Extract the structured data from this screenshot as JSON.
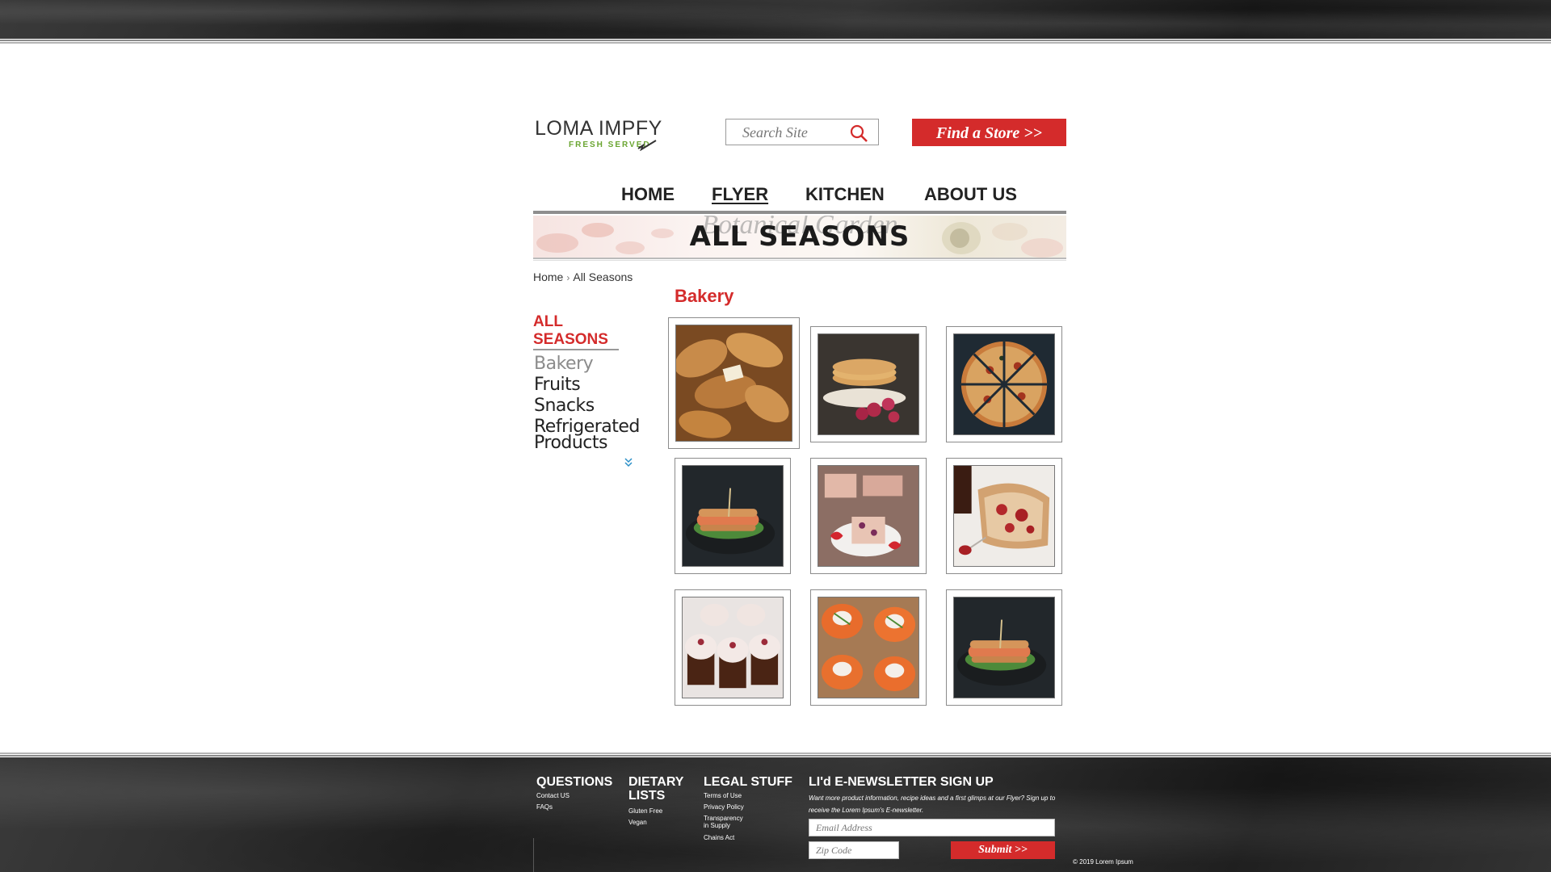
{
  "header": {
    "logo": {
      "brand": "LOMA IMPFY",
      "tagline": "FRESH SERVED"
    },
    "search": {
      "placeholder": "Search Site"
    },
    "find_store_label": "Find a Store >>"
  },
  "nav": {
    "items": [
      {
        "label": "HOME",
        "active": false
      },
      {
        "label": "FLYER",
        "active": true
      },
      {
        "label": "KITCHEN",
        "active": false
      },
      {
        "label": "ABOUT US",
        "active": false
      }
    ]
  },
  "banner": {
    "script_text": "Botanical Garden",
    "title": "ALL SEASONS"
  },
  "breadcrumb": {
    "home": "Home",
    "separator": "›",
    "current": "All Seasons"
  },
  "sidebar": {
    "heading": "ALL SEASONS",
    "items": [
      {
        "label": "Bakery",
        "current": true
      },
      {
        "label": "Fruits",
        "current": false
      },
      {
        "label": "Snacks",
        "current": false
      },
      {
        "label": "Refrigerated Products",
        "current": false
      }
    ],
    "more_icon": "chevron-double-down-icon"
  },
  "content": {
    "category_title": "Bakery",
    "products": [
      {
        "image": "bread-loaves",
        "selected": true
      },
      {
        "image": "pancakes-raspberries",
        "selected": false
      },
      {
        "image": "pizza-slices",
        "selected": false
      },
      {
        "image": "salmon-sandwich",
        "selected": false
      },
      {
        "image": "strawberry-cake",
        "selected": false
      },
      {
        "image": "bread-with-jam",
        "selected": false
      },
      {
        "image": "cupcakes",
        "selected": false
      },
      {
        "image": "salmon-canapes",
        "selected": false
      },
      {
        "image": "salmon-sandwich",
        "selected": false
      }
    ]
  },
  "footer": {
    "questions": {
      "title": "QUESTIONS",
      "links": [
        "Contact US",
        "FAQs"
      ]
    },
    "dietary": {
      "title": "DIETARY LISTS",
      "links": [
        "Gluten Free",
        "Vegan"
      ]
    },
    "legal": {
      "title": "LEGAL STUFF",
      "links": [
        "Terms of Use",
        "Privacy Policy",
        "Transparency in Supply",
        "Chains Act"
      ]
    },
    "newsletter": {
      "title": "LI'd E-NEWSLETTER SIGN UP",
      "description": "Want more product information, recipe ideas and a first glimps at our Flyer? Sign up to receive the Lorem Ipsum's E-newsletter.",
      "email_placeholder": "Email Address",
      "zip_placeholder": "Zip Code",
      "submit_label": "Submit >>"
    },
    "copyright": "© 2019 Lorem Ipsum"
  },
  "colors": {
    "accent": "#d42b2b",
    "logo_green": "#6aa531",
    "text": "#222222",
    "footer_stone": "#2c2c2c"
  }
}
